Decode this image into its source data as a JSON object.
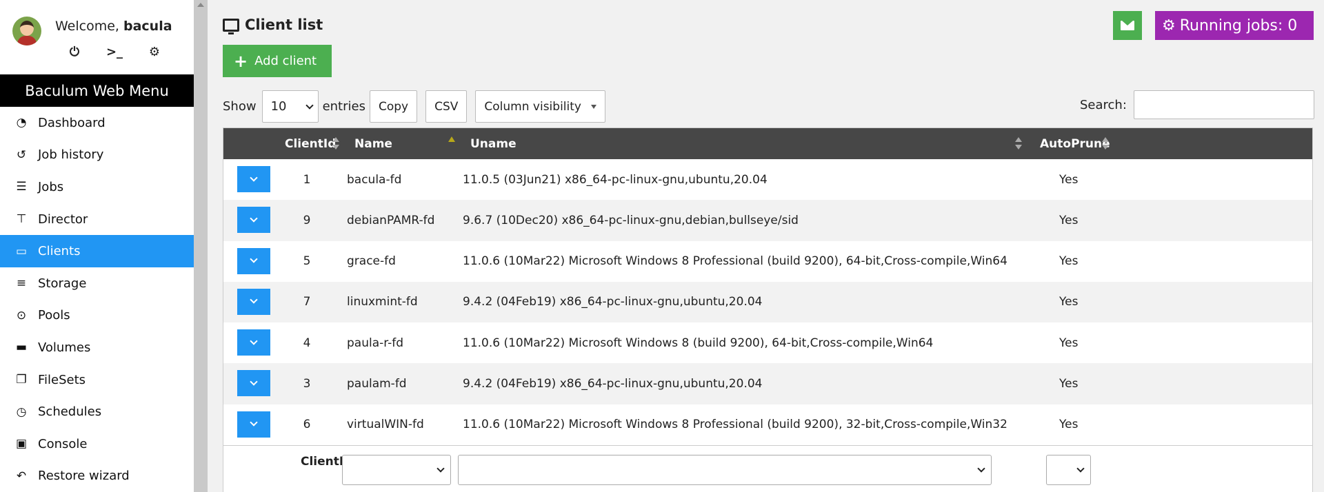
{
  "user": {
    "welcome": "Welcome,",
    "username": "bacula",
    "icons": [
      "power-icon",
      "terminal-icon",
      "gear-icon"
    ]
  },
  "menu": {
    "title": "Baculum Web Menu",
    "items": [
      {
        "label": "Dashboard",
        "icon": "dashboard-icon",
        "active": false
      },
      {
        "label": "Job history",
        "icon": "history-icon",
        "active": false
      },
      {
        "label": "Jobs",
        "icon": "tasks-icon",
        "active": false
      },
      {
        "label": "Director",
        "icon": "sitemap-icon",
        "active": false
      },
      {
        "label": "Clients",
        "icon": "desktop-icon",
        "active": true
      },
      {
        "label": "Storage",
        "icon": "database-icon",
        "active": false
      },
      {
        "label": "Pools",
        "icon": "tape-icon",
        "active": false
      },
      {
        "label": "Volumes",
        "icon": "hdd-icon",
        "active": false
      },
      {
        "label": "FileSets",
        "icon": "copy-icon",
        "active": false
      },
      {
        "label": "Schedules",
        "icon": "clock-icon",
        "active": false
      },
      {
        "label": "Console",
        "icon": "laptop-code-icon",
        "active": false
      },
      {
        "label": "Restore wizard",
        "icon": "undo-icon",
        "active": false
      }
    ]
  },
  "header": {
    "title": "Client list",
    "running_jobs": "Running jobs: 0",
    "add_client": "Add client"
  },
  "controls": {
    "show_label": "Show",
    "entries_value": "10",
    "entries_label": "entries",
    "copy": "Copy",
    "csv": "CSV",
    "column_visibility": "Column visibility",
    "search_label": "Search:"
  },
  "table": {
    "columns": [
      "ClientId",
      "Name",
      "Uname",
      "AutoPrune"
    ],
    "rows": [
      {
        "id": "1",
        "name": "bacula-fd",
        "uname": "11.0.5 (03Jun21) x86_64-pc-linux-gnu,ubuntu,20.04",
        "autoprune": "Yes"
      },
      {
        "id": "9",
        "name": "debianPAMR-fd",
        "uname": "9.6.7 (10Dec20) x86_64-pc-linux-gnu,debian,bullseye/sid",
        "autoprune": "Yes"
      },
      {
        "id": "5",
        "name": "grace-fd",
        "uname": "11.0.6 (10Mar22) Microsoft Windows 8 Professional (build 9200), 64-bit,Cross-compile,Win64",
        "autoprune": "Yes"
      },
      {
        "id": "7",
        "name": "linuxmint-fd",
        "uname": "9.4.2 (04Feb19) x86_64-pc-linux-gnu,ubuntu,20.04",
        "autoprune": "Yes"
      },
      {
        "id": "4",
        "name": "paula-r-fd",
        "uname": "11.0.6 (10Mar22) Microsoft Windows 8 (build 9200), 64-bit,Cross-compile,Win64",
        "autoprune": "Yes"
      },
      {
        "id": "3",
        "name": "paulam-fd",
        "uname": "9.4.2 (04Feb19) x86_64-pc-linux-gnu,ubuntu,20.04",
        "autoprune": "Yes"
      },
      {
        "id": "6",
        "name": "virtualWIN-fd",
        "uname": "11.0.6 (10Mar22) Microsoft Windows 8 Professional (build 9200), 32-bit,Cross-compile,Win32",
        "autoprune": "Yes"
      }
    ],
    "footer_label": "ClientId"
  },
  "colors": {
    "accent": "#2196f3",
    "green": "#4caf50",
    "purple": "#9c27b0",
    "header_bg": "#474747"
  }
}
